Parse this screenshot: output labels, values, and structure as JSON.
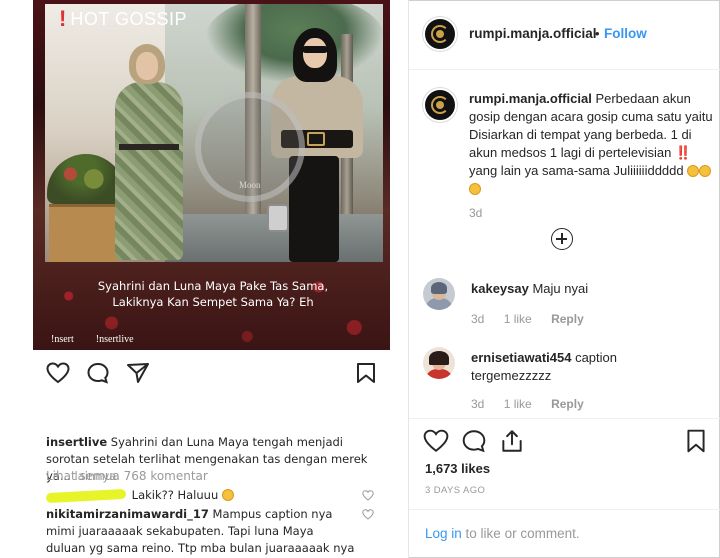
{
  "left_post": {
    "badge_text": "HOT GOSSIP",
    "badge_bang": "!",
    "image_caption_line1": "Syahrini dan Luna Maya Pake Tas Sama,",
    "image_caption_line2": "Lakiknya Kan Sempet Sama Ya? Eh",
    "watermark": "Moon",
    "brand_1": "!nsert",
    "brand_2": "!nsertlive",
    "caption_user": "insertlive",
    "caption_text": "Syahrini dan Luna Maya tengah menjadi sorotan setelah terlihat mengenakan tas dengan merek ya...",
    "caption_more": "lainnya",
    "view_all": "Lihat semua 768 komentar",
    "comment1_text": "Lakik?? Haluuu",
    "comment2_user": "nikitamirzanimawardi_17",
    "comment2_text": "Mampus caption nya mimi juaraaaaak sekabupaten. Tapi luna Maya duluan yg sama reino. Ttp mba bulan juaraaaaak nya . Kikuuuuk!!"
  },
  "header": {
    "username": "rumpi.manja.official",
    "separator": "•",
    "follow_label": "Follow"
  },
  "caption": {
    "username": "rumpi.manja.official",
    "text": "Perbedaan akun gosip dengan acara gosip cuma satu yaitu Disiarkan di tempat yang berbeda. 1 di akun medsos 1 lagi di pertelevisian ‼️ yang lain ya sama-sama Juliiiiiiddddd",
    "time": "3d"
  },
  "comments": [
    {
      "username": "kakeysay",
      "text": "Maju nyai",
      "time": "3d",
      "likes": "1 like",
      "reply": "Reply"
    },
    {
      "username": "ernisetiawati454",
      "text": "caption tergemezzzzz",
      "time": "3d",
      "likes": "1 like",
      "reply": "Reply"
    }
  ],
  "stats": {
    "likes": "1,673 likes",
    "date": "3 DAYS AGO"
  },
  "login": {
    "link": "Log in",
    "rest": " to like or comment."
  },
  "colors": {
    "link_blue": "#3897f0",
    "text_dark": "#262626",
    "text_muted": "#999999",
    "badge_red": "#e03030"
  },
  "icons": [
    "heart-icon",
    "comment-icon",
    "share-icon",
    "bookmark-icon",
    "add-circle-icon"
  ]
}
